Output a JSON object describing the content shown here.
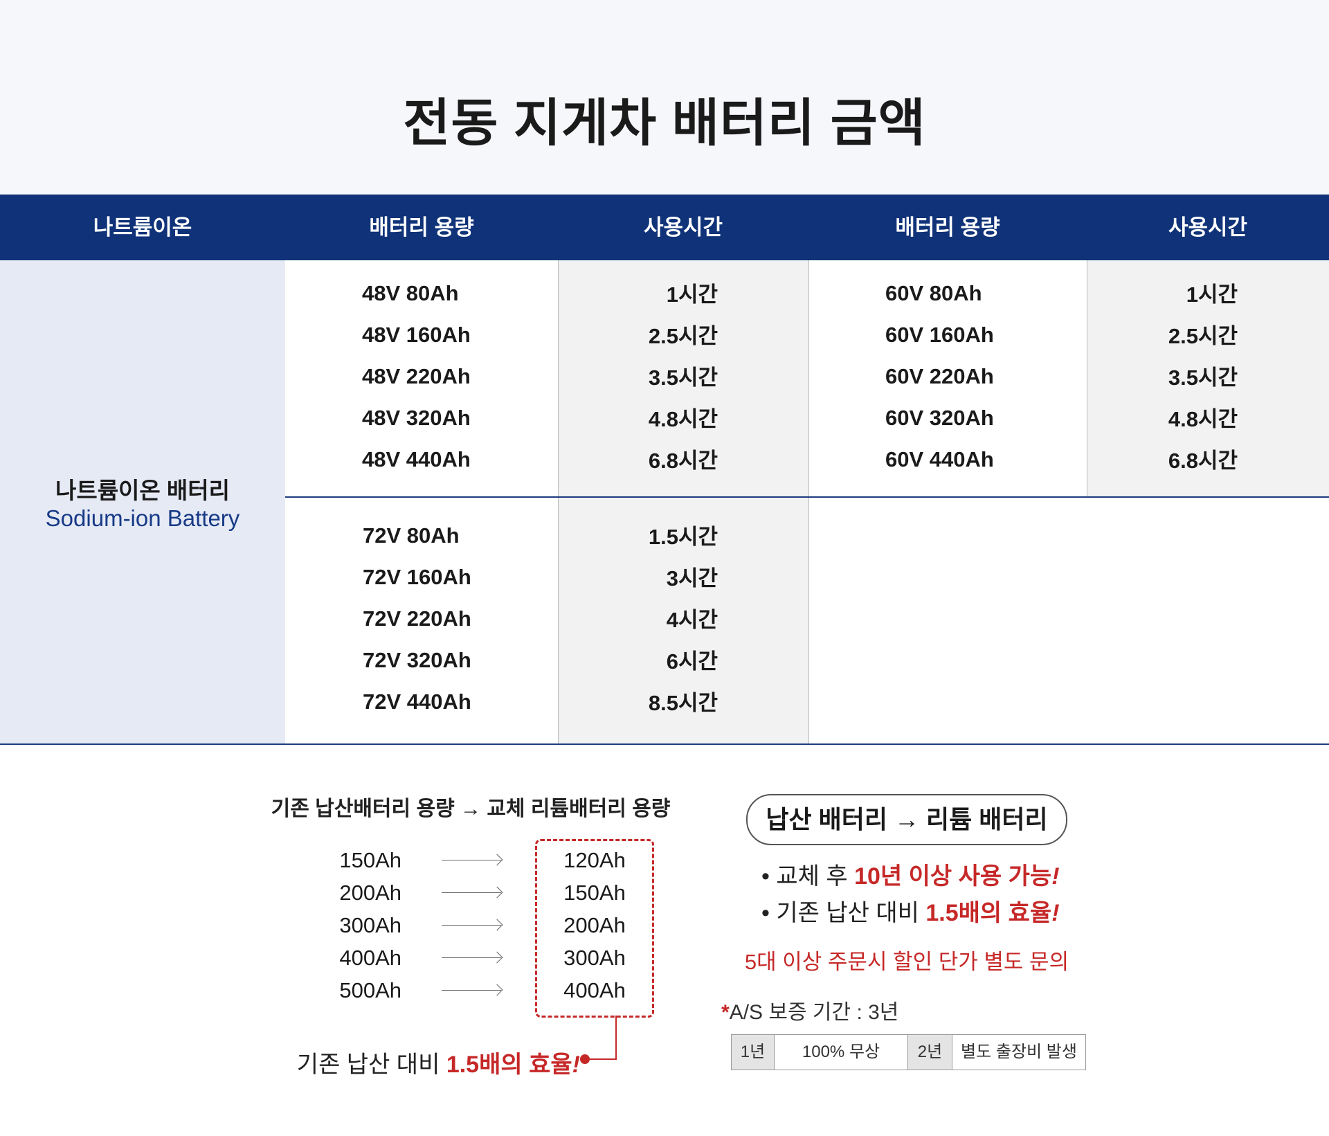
{
  "title": "전동 지게차 배터리 금액",
  "header": [
    "나트륨이온",
    "배터리 용량",
    "사용시간",
    "배터리 용량",
    "사용시간"
  ],
  "category": {
    "ko": "나트륨이온 배터리",
    "en": "Sodium-ion Battery"
  },
  "group48": {
    "capacities": [
      "48V 80Ah",
      "48V 160Ah",
      "48V 220Ah",
      "48V 320Ah",
      "48V 440Ah"
    ],
    "times": [
      "1시간",
      "2.5시간",
      "3.5시간",
      "4.8시간",
      "6.8시간"
    ]
  },
  "group60": {
    "capacities": [
      "60V 80Ah",
      "60V 160Ah",
      "60V 220Ah",
      "60V 320Ah",
      "60V 440Ah"
    ],
    "times": [
      "1시간",
      "2.5시간",
      "3.5시간",
      "4.8시간",
      "6.8시간"
    ]
  },
  "group72": {
    "capacities": [
      "72V 80Ah",
      "72V 160Ah",
      "72V 220Ah",
      "72V 320Ah",
      "72V 440Ah"
    ],
    "times": [
      "1.5시간",
      "3시간",
      "4시간",
      "6시간",
      "8.5시간"
    ]
  },
  "conversion": {
    "title": "기존 납산배터리 용량 → 교체 리튬배터리 용량",
    "lead_acid": [
      "150Ah",
      "200Ah",
      "300Ah",
      "400Ah",
      "500Ah"
    ],
    "lithium": [
      "120Ah",
      "150Ah",
      "200Ah",
      "300Ah",
      "400Ah"
    ],
    "efficiency_prefix": "기존 납산 대비 ",
    "efficiency_highlight": "1.5배의 효율",
    "efficiency_mark": "!"
  },
  "benefits": {
    "pill": "납산 배터리 → 리튬 배터리",
    "b1_prefix": "• 교체 후 ",
    "b1_highlight": "10년 이상 사용 가능",
    "b2_prefix": "• 기존 납산 대비 ",
    "b2_highlight": "1.5배의 효율",
    "mark": "!",
    "notice": "5대 이상 주문시 할인 단가 별도 문의"
  },
  "warranty": {
    "star": "*",
    "label": "A/S 보증 기간 : 3년",
    "cells": [
      "1년",
      "100% 무상",
      "2년",
      "별도 출장비 발생"
    ]
  },
  "colors": {
    "navy": "#0f3278",
    "red": "#c62828",
    "light_blue": "#e6eaf5",
    "grey": "#f2f2f2"
  }
}
